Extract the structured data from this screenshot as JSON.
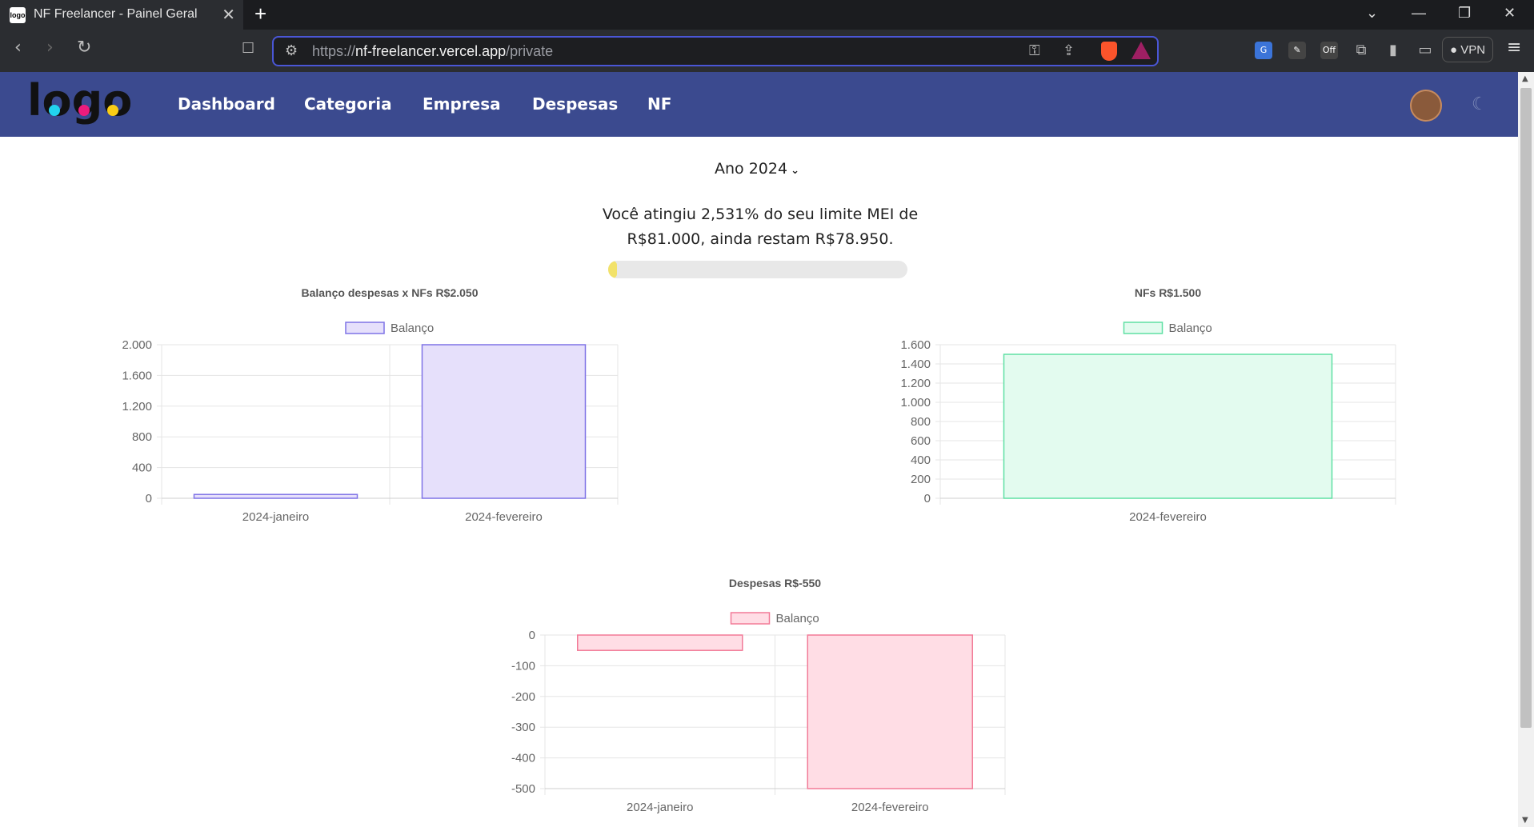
{
  "browser": {
    "tab_title": "NF Freelancer - Painel Geral",
    "favicon_text": "logo",
    "url_scheme": "https://",
    "url_host": "nf-freelancer.vercel.app",
    "url_path": "/private",
    "vpn_label": "VPN",
    "ext_off_label": "Off"
  },
  "app": {
    "logo_text": "logo",
    "nav": [
      "Dashboard",
      "Categoria",
      "Empresa",
      "Despesas",
      "NF"
    ]
  },
  "main": {
    "year_label": "Ano 2024",
    "limit_text_line1": "Você atingiu 2,531% do seu limite MEI de",
    "limit_text_line2": "R$81.000, ainda restam R$78.950.",
    "progress_fraction": 0.02531,
    "colors": {
      "nav_bg": "#3b4a8f",
      "progress_fill": "#f2e26a"
    }
  },
  "chart_data": [
    {
      "type": "bar",
      "title": "Balanço despesas x NFs R$2.050",
      "categories": [
        "2024-janeiro",
        "2024-fevereiro"
      ],
      "series": [
        {
          "name": "Balanço",
          "values": [
            50,
            2000
          ]
        }
      ],
      "ylim": [
        0,
        2000
      ],
      "yticks": [
        "2.000",
        "1.600",
        "1.200",
        "800",
        "400",
        "0"
      ],
      "ytick_values": [
        2000,
        1600,
        1200,
        800,
        400,
        0
      ],
      "fill": "#e6e0fb",
      "stroke": "#7f73e6",
      "grid": true,
      "legend": "top"
    },
    {
      "type": "bar",
      "title": "NFs R$1.500",
      "categories": [
        "2024-fevereiro"
      ],
      "series": [
        {
          "name": "Balanço",
          "values": [
            1500
          ]
        }
      ],
      "ylim": [
        0,
        1600
      ],
      "yticks": [
        "1.600",
        "1.400",
        "1.200",
        "1.000",
        "800",
        "600",
        "400",
        "200",
        "0"
      ],
      "ytick_values": [
        1600,
        1400,
        1200,
        1000,
        800,
        600,
        400,
        200,
        0
      ],
      "fill": "#e3fbef",
      "stroke": "#5fe0a4",
      "grid": true,
      "legend": "top"
    },
    {
      "type": "bar",
      "title": "Despesas R$-550",
      "categories": [
        "2024-janeiro",
        "2024-fevereiro"
      ],
      "series": [
        {
          "name": "Balanço",
          "values": [
            -50,
            -500
          ]
        }
      ],
      "ylim": [
        -500,
        0
      ],
      "yticks": [
        "0",
        "-100",
        "-200",
        "-300",
        "-400",
        "-500"
      ],
      "ytick_values": [
        0,
        -100,
        -200,
        -300,
        -400,
        -500
      ],
      "fill": "#ffdde5",
      "stroke": "#f27a97",
      "grid": true,
      "legend": "top"
    }
  ]
}
